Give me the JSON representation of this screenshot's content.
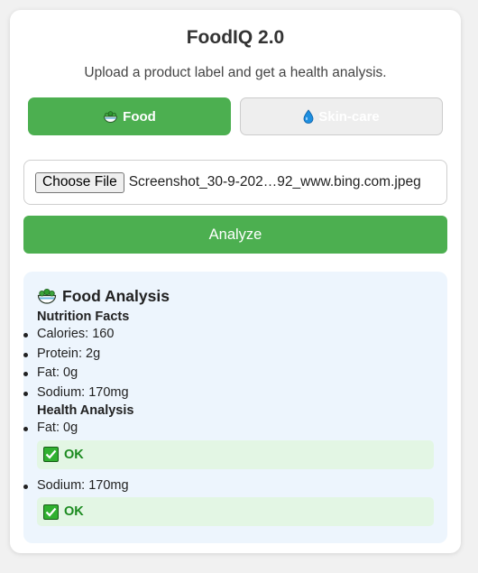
{
  "app": {
    "title": "FoodIQ 2.0",
    "subtitle": "Upload a product label and get a health analysis."
  },
  "tabs": [
    {
      "label": "Food",
      "icon": "salad-bowl-icon",
      "active": true
    },
    {
      "label": "Skin-care",
      "icon": "water-drop-icon",
      "active": false
    }
  ],
  "upload": {
    "button_label": "Choose File",
    "file_name": "Screenshot_30-9-202…92_www.bing.com.jpeg"
  },
  "analyze_label": "Analyze",
  "results": {
    "heading": "Food Analysis",
    "nutrition_title": "Nutrition Facts",
    "nutrition_items": [
      "Calories: 160",
      "Protein: 2g",
      "Fat: 0g",
      "Sodium: 170mg"
    ],
    "health_title": "Health Analysis",
    "health_items": [
      {
        "item": "Fat: 0g",
        "status": "OK"
      },
      {
        "item": "Sodium: 170mg",
        "status": "OK"
      }
    ]
  },
  "colors": {
    "accent": "#4caf50",
    "results_bg": "#edf5fd",
    "ok_bg": "#e3f6e4",
    "ok_text": "#1b8a1f"
  }
}
